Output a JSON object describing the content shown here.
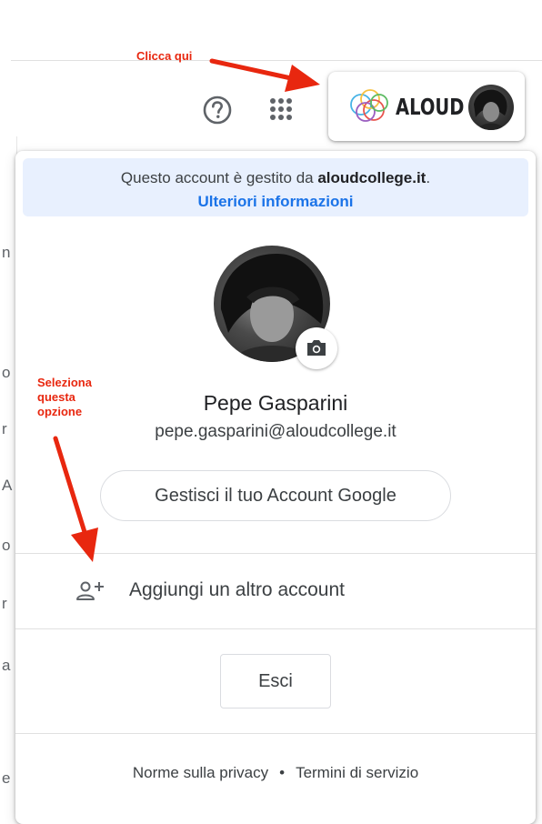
{
  "header": {
    "help_icon": "help-circle-icon",
    "apps_icon": "apps-grid-icon",
    "account_chip": {
      "brand": "ALOUD",
      "logo_icon": "aloud-logo-icon",
      "avatar": "profile-avatar"
    }
  },
  "panel": {
    "managed_notice": {
      "prefix": "Questo account è gestito da ",
      "domain": "aloudcollege.it",
      "suffix": ".",
      "link": "Ulteriori informazioni"
    },
    "profile": {
      "name": "Pepe Gasparini",
      "email": "pepe.gasparini@aloudcollege.it",
      "camera_icon": "camera-icon"
    },
    "manage_button": "Gestisci il tuo Account Google",
    "add_account": {
      "icon": "person-add-icon",
      "label": "Aggiungi un altro account"
    },
    "signout_button": "Esci",
    "footer": {
      "privacy": "Norme sulla privacy",
      "separator": "•",
      "terms": "Termini di servizio"
    }
  },
  "annotations": {
    "top": "Clicca qui",
    "left": [
      "Seleziona",
      "questa",
      "opzione"
    ],
    "color": "#e8270f"
  },
  "background_fragments": [
    "n",
    "o",
    "r",
    "A",
    "o",
    "r",
    "a",
    "e"
  ]
}
